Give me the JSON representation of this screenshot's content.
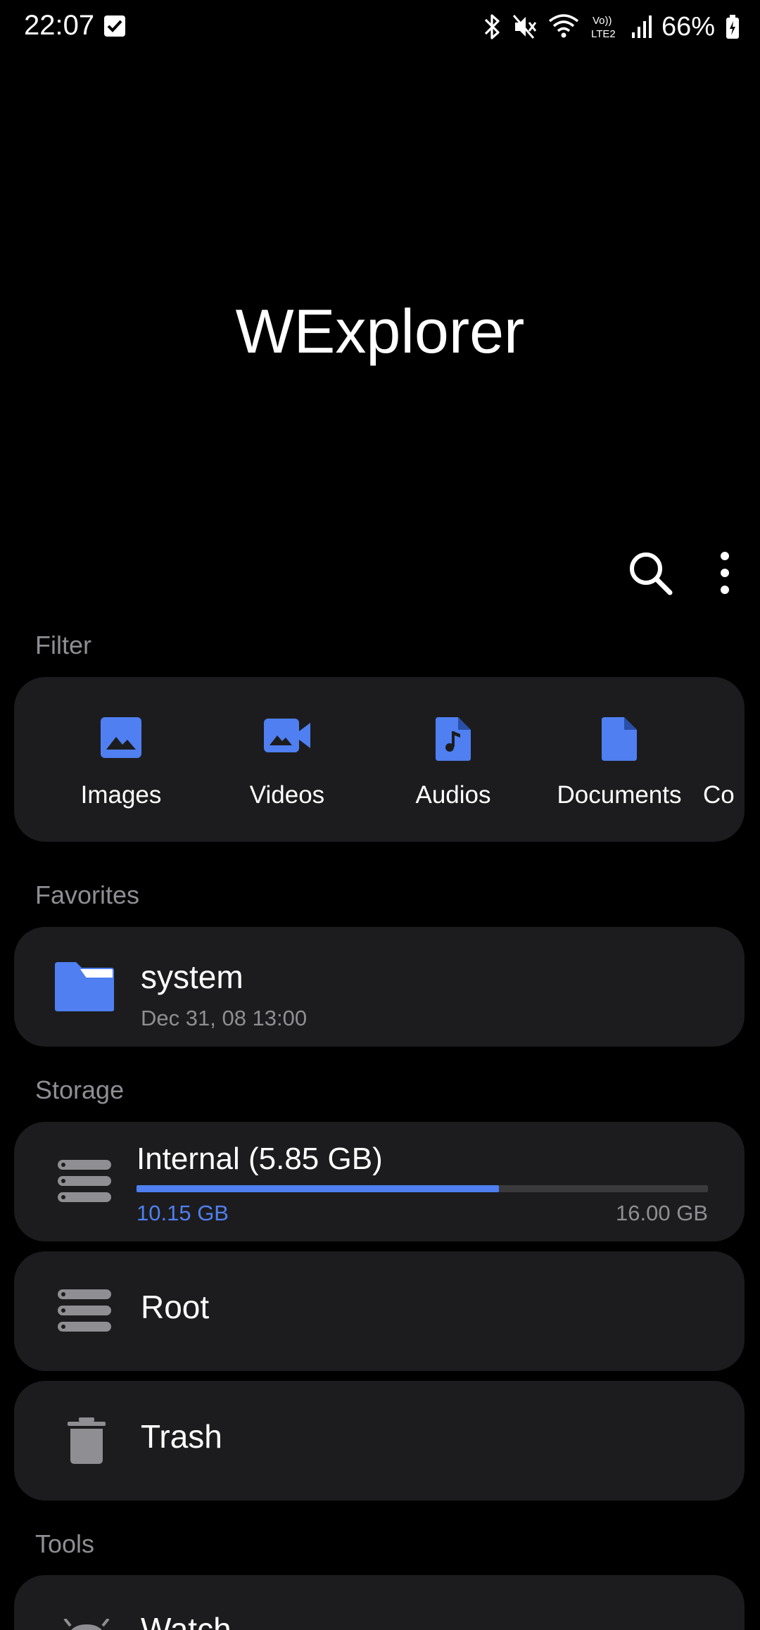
{
  "status_bar": {
    "time": "22:07",
    "battery": "66%",
    "icons": [
      "checkbox-icon",
      "bluetooth-icon",
      "mute-icon",
      "wifi-icon",
      "volte-icon",
      "signal-icon",
      "battery-icon"
    ],
    "volte_label": "Vo)) LTE2"
  },
  "header": {
    "title": "WExplorer",
    "search_icon": "search-icon",
    "more_icon": "more-vert-icon"
  },
  "filter": {
    "label": "Filter",
    "items": [
      {
        "label": "Images",
        "icon": "image-icon"
      },
      {
        "label": "Videos",
        "icon": "video-icon"
      },
      {
        "label": "Audios",
        "icon": "audio-file-icon"
      },
      {
        "label": "Documents",
        "icon": "document-icon"
      },
      {
        "label": "Co",
        "icon": ""
      }
    ]
  },
  "favorites": {
    "label": "Favorites",
    "items": [
      {
        "name": "system",
        "date": "Dec 31, 08 13:00",
        "icon": "folder-icon"
      }
    ]
  },
  "storage": {
    "label": "Storage",
    "internal": {
      "title": "Internal (5.85 GB)",
      "used": "10.15 GB",
      "total": "16.00 GB",
      "used_fraction": 0.634
    },
    "root": {
      "label": "Root"
    },
    "trash": {
      "label": "Trash"
    }
  },
  "tools": {
    "label": "Tools",
    "items": [
      {
        "label": "Watch"
      }
    ]
  },
  "colors": {
    "accent": "#4f7ff0",
    "card": "#1c1c1e",
    "muted": "#8e8e93",
    "background": "#000000"
  }
}
